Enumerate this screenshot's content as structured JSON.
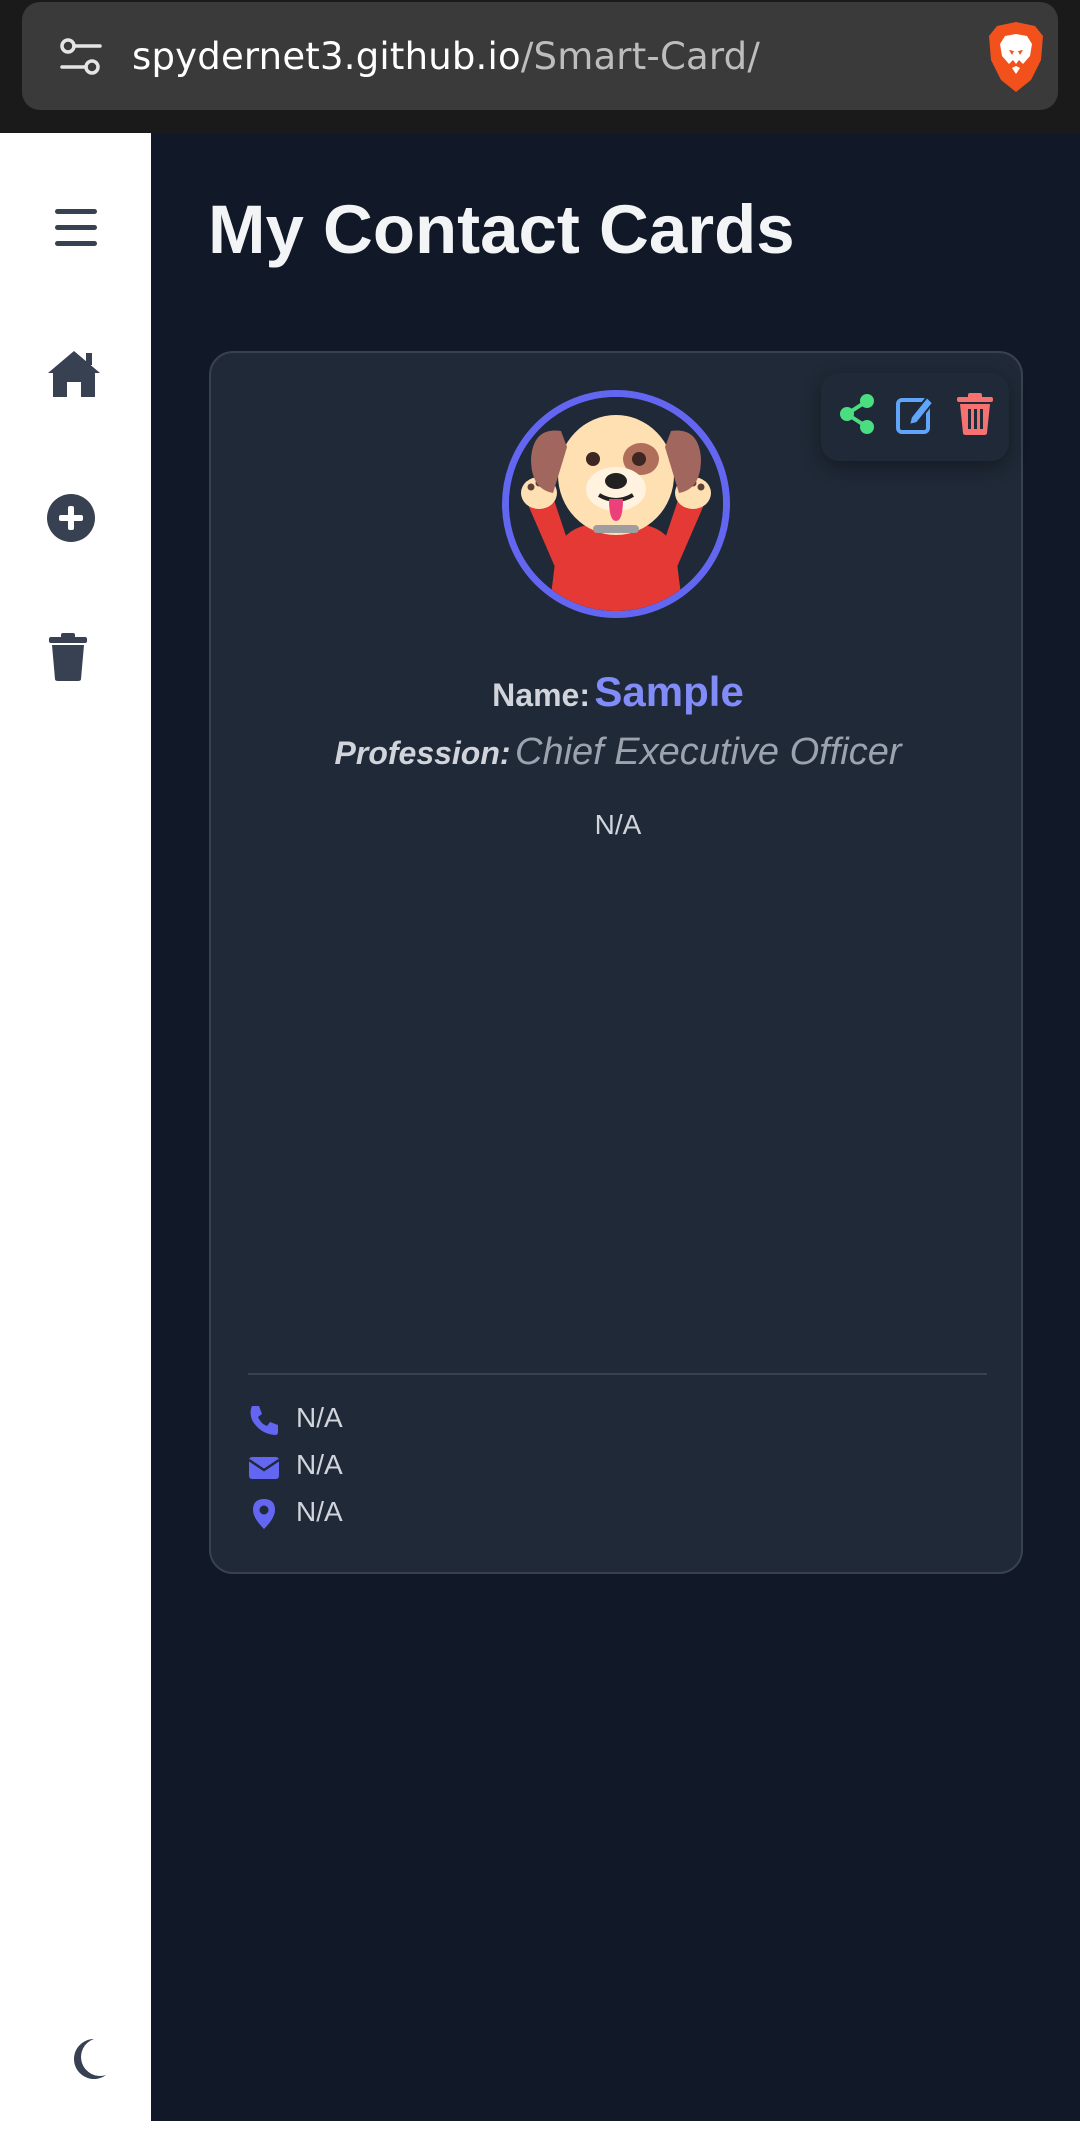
{
  "browser": {
    "url_host": "spydernet3.github.io",
    "url_path": "/Smart-Card/"
  },
  "sidebar": {
    "items": [
      {
        "icon": "hamburger-menu-icon"
      },
      {
        "icon": "home-icon"
      },
      {
        "icon": "plus-circle-icon"
      },
      {
        "icon": "trash-icon"
      }
    ],
    "footer_icon": "moon-icon"
  },
  "main": {
    "title": "My Contact Cards"
  },
  "card": {
    "name_label": "Name:",
    "name_value": "Sample",
    "profession_label": "Profession:",
    "profession_value": "Chief Executive Officer",
    "bio": "N/A",
    "phone": "N/A",
    "email": "N/A",
    "location": "N/A",
    "actions": [
      "share-icon",
      "edit-icon",
      "delete-icon"
    ]
  },
  "colors": {
    "background": "#111827",
    "card": "#1f2937",
    "accent": "#6366f1",
    "name": "#818cf8",
    "share": "#4ade80",
    "edit": "#60a5fa",
    "delete": "#f87171",
    "sidebar_icon": "#374151"
  }
}
